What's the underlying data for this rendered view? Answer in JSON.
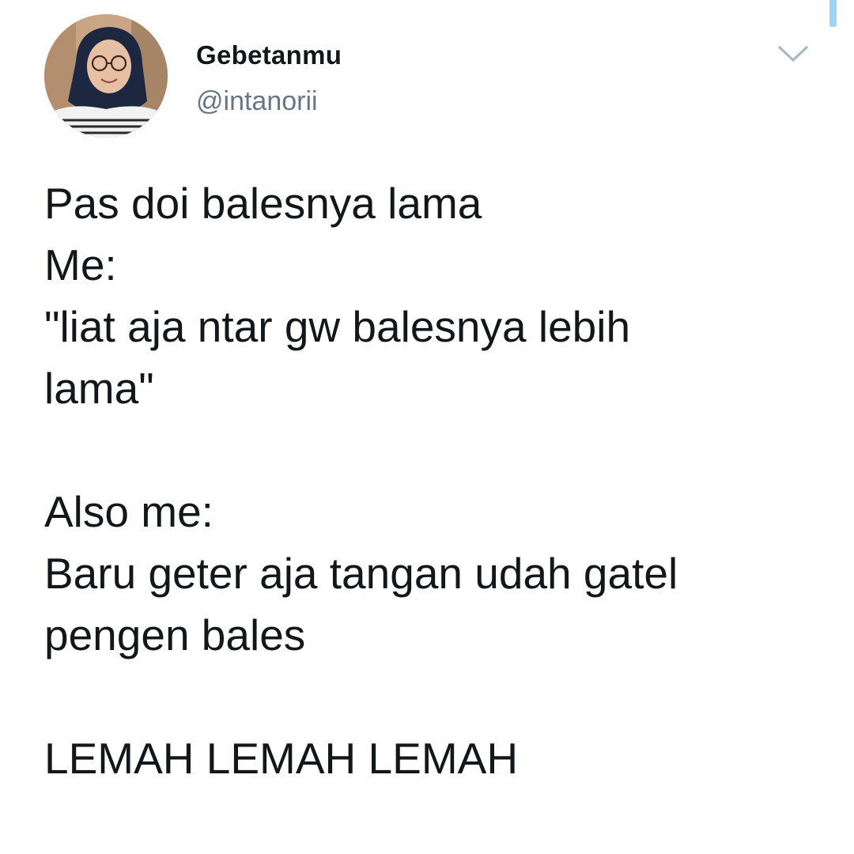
{
  "tweet": {
    "author": {
      "display_name": "Gebetanmu",
      "handle": "@intanorii",
      "avatar": "profile-photo"
    },
    "menu_icon": "chevron-down-icon",
    "text_lines": [
      "Pas doi balesnya lama",
      "Me:",
      "\"liat aja ntar gw balesnya lebih",
      "lama\"",
      "",
      "Also me:",
      "Baru geter aja tangan udah gatel",
      "pengen bales",
      "",
      "LEMAH LEMAH LEMAH"
    ]
  },
  "colors": {
    "text": "#14171a",
    "secondary_text": "#657786",
    "accent": "#1da1f2",
    "scroll_indicator": "#9fd3f5",
    "background": "#ffffff"
  }
}
